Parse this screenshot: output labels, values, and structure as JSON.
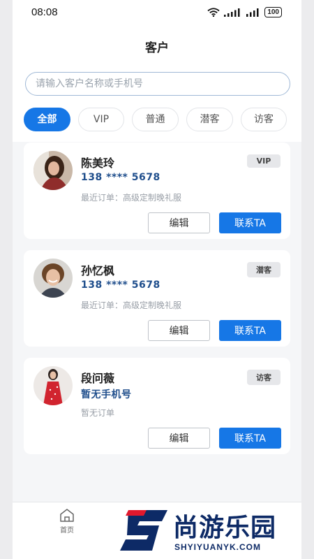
{
  "status_bar": {
    "time": "08:08",
    "battery": "100"
  },
  "header": {
    "title": "客户"
  },
  "search": {
    "placeholder": "请输入客户名称或手机号"
  },
  "filters": [
    "全部",
    "VIP",
    "普通",
    "潜客",
    "访客"
  ],
  "active_filter": "全部",
  "customers": [
    {
      "name": "陈美玲",
      "phone": "138 **** 5678",
      "order": "最近订单：高级定制晚礼服",
      "tag": "VIP",
      "edit_label": "编辑",
      "contact_label": "联系TA"
    },
    {
      "name": "孙忆枫",
      "phone": "138 **** 5678",
      "order": "最近订单：高级定制晚礼服",
      "tag": "潜客",
      "edit_label": "编辑",
      "contact_label": "联系TA"
    },
    {
      "name": "段问薇",
      "phone": "暂无手机号",
      "order": "暂无订单",
      "tag": "访客",
      "edit_label": "编辑",
      "contact_label": "联系TA"
    }
  ],
  "tabbar": {
    "home_label": "首页"
  },
  "watermark": {
    "brand": "尚游乐园",
    "url": "SHYIYUANYK.COM"
  },
  "colors": {
    "accent": "#1677e6",
    "phone_text": "#1f4e8c",
    "watermark": "#0d2a66",
    "watermark_red": "#e0182d"
  }
}
